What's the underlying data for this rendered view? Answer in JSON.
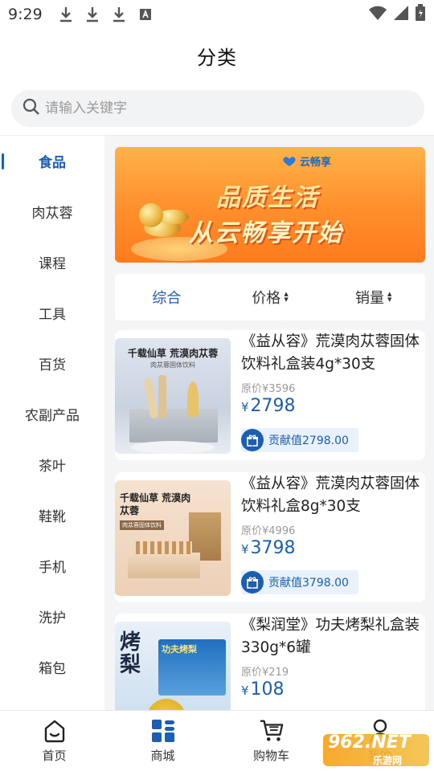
{
  "status_bar": {
    "time": "9:29"
  },
  "header": {
    "title": "分类"
  },
  "search": {
    "placeholder": "请输入关键字"
  },
  "sidebar": {
    "items": [
      {
        "label": "食品",
        "active": true
      },
      {
        "label": "肉苁蓉"
      },
      {
        "label": "课程"
      },
      {
        "label": "工具"
      },
      {
        "label": "百货"
      },
      {
        "label": "农副产品"
      },
      {
        "label": "茶叶"
      },
      {
        "label": "鞋靴"
      },
      {
        "label": "手机"
      },
      {
        "label": "洗护"
      },
      {
        "label": "箱包"
      }
    ]
  },
  "banner": {
    "logo_text": "云畅享",
    "line1": "品质生活",
    "line2": "从云畅享开始"
  },
  "sort": {
    "items": [
      {
        "label": "综合",
        "active": true
      },
      {
        "label": "价格"
      },
      {
        "label": "销量"
      }
    ]
  },
  "products": [
    {
      "name": "《益从容》荒漠肉苁蓉固体饮料礼盒装4g*30支",
      "orig_price": "原价¥3596",
      "currency": "¥",
      "price": "2798",
      "contribution": "贡献值2798.00",
      "img_title": "千载仙草 荒漠肉苁蓉",
      "img_sub": "肉苁蓉固体饮料"
    },
    {
      "name": "《益从容》荒漠肉苁蓉固体饮料礼盒8g*30支",
      "orig_price": "原价¥4996",
      "currency": "¥",
      "price": "3798",
      "contribution": "贡献值3798.00",
      "img_title": "千载仙草 荒漠肉苁蓉",
      "img_sub": "肉苁蓉固体饮料"
    },
    {
      "name": "《梨润堂》功夫烤梨礼盒装330g*6罐",
      "orig_price": "原价¥219",
      "currency": "¥",
      "price": "108",
      "img_title": "烤梨",
      "img_sub": "功夫烤梨"
    }
  ],
  "bottom_nav": {
    "items": [
      {
        "label": "首页",
        "icon": "home-icon"
      },
      {
        "label": "商城",
        "icon": "grid-icon",
        "active": true
      },
      {
        "label": "购物车",
        "icon": "cart-icon"
      },
      {
        "label": "我的",
        "icon": "user-icon"
      }
    ]
  },
  "watermark": {
    "text": "962.NET",
    "sub": "乐游网"
  },
  "colors": {
    "accent": "#1a5fb4",
    "price": "#1a5fb4",
    "banner": "#ff8e2b"
  }
}
